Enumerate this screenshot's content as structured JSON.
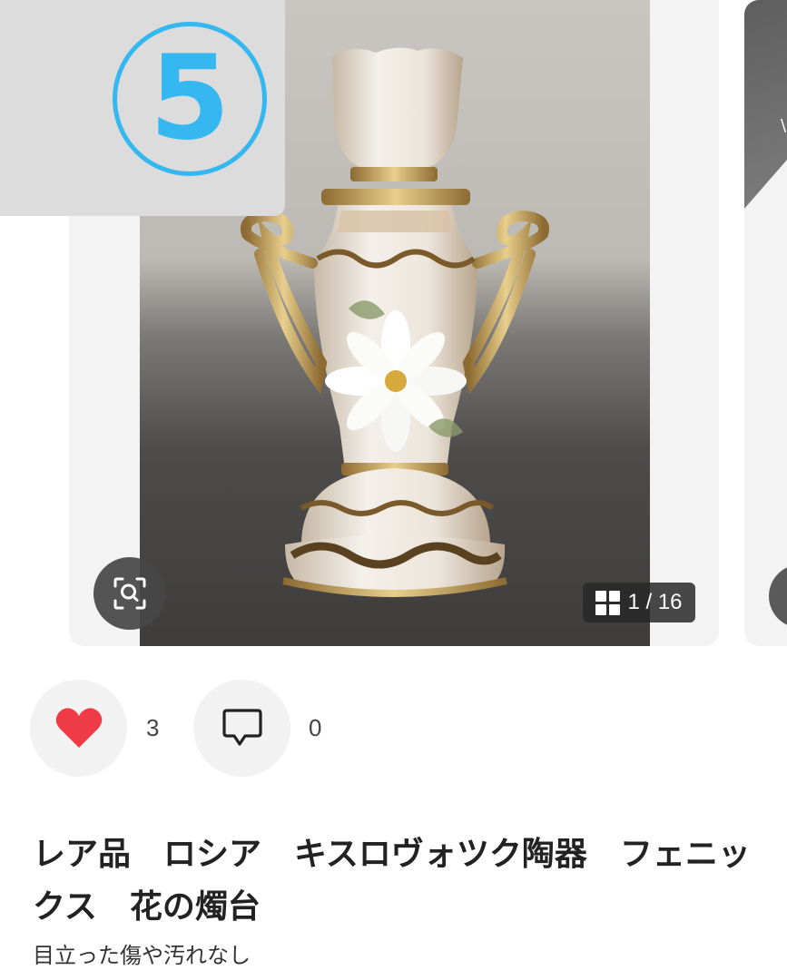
{
  "carousel": {
    "badge_number": "⑤",
    "counter": "1 / 16",
    "icons": {
      "zoom": "zoom-scan-icon",
      "grid": "grid-icon"
    }
  },
  "actions": {
    "like_count": "3",
    "comment_count": "0",
    "like_color": "#ee3b46",
    "icons": {
      "like": "heart-icon",
      "comment": "comment-icon"
    }
  },
  "item": {
    "title": "レア品　ロシア　キスロヴォツク陶器　フェニックス　花の燭台",
    "description": "目立った傷や汚れなし"
  }
}
